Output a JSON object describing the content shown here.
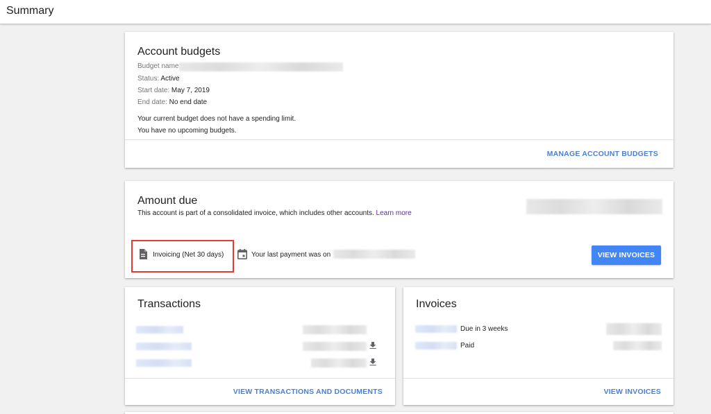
{
  "header": {
    "title": "Summary"
  },
  "account_budgets": {
    "title": "Account budgets",
    "budget_name_label": "Budget name:",
    "status_label": "Status:",
    "status_value": "Active",
    "start_label": "Start date:",
    "start_value": "May 7, 2019",
    "end_label": "End date:",
    "end_value": "No end date",
    "note1": "Your current budget does not have a spending limit.",
    "note2": "You have no upcoming budgets.",
    "manage_label": "MANAGE ACCOUNT BUDGETS"
  },
  "amount_due": {
    "title": "Amount due",
    "description": "This account is part of a consolidated invoice, which includes other accounts.",
    "learn_more": "Learn more",
    "invoicing_label": "Invoicing (Net 30 days)",
    "last_payment_label": "Your last payment was on",
    "view_invoices_label": "VIEW INVOICES",
    "icons": {
      "invoice": "document-icon",
      "calendar": "calendar-icon"
    }
  },
  "transactions": {
    "title": "Transactions",
    "view_label": "VIEW TRANSACTIONS AND DOCUMENTS"
  },
  "invoices": {
    "title": "Invoices",
    "rows": [
      {
        "status": "Due in 3 weeks"
      },
      {
        "status": "Paid"
      }
    ],
    "view_label": "VIEW INVOICES"
  },
  "colors": {
    "accent": "#4285f4",
    "link": "#4a7fd6",
    "learn_more": "#5f2c9e",
    "highlight": "#e53935"
  }
}
